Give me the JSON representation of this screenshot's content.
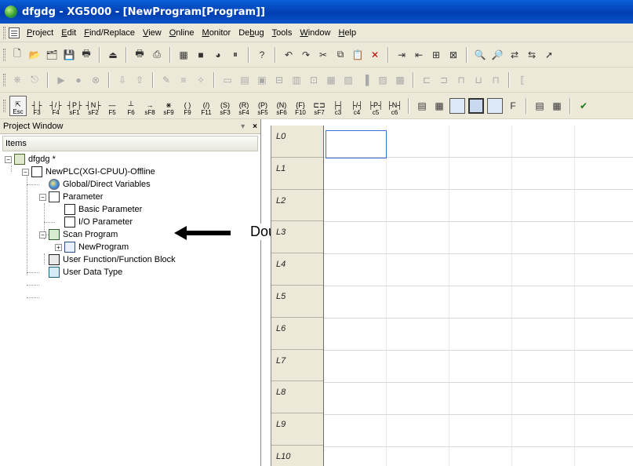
{
  "window": {
    "title": "dfgdg - XG5000 - [NewProgram[Program]]"
  },
  "menubar": {
    "items": [
      {
        "label": "Project",
        "accel": "P"
      },
      {
        "label": "Edit",
        "accel": "E"
      },
      {
        "label": "Find/Replace",
        "accel": "F"
      },
      {
        "label": "View",
        "accel": "V"
      },
      {
        "label": "Online",
        "accel": "O"
      },
      {
        "label": "Monitor",
        "accel": "M"
      },
      {
        "label": "Debug",
        "accel": "b"
      },
      {
        "label": "Tools",
        "accel": "T"
      },
      {
        "label": "Window",
        "accel": "W"
      },
      {
        "label": "Help",
        "accel": "H"
      }
    ]
  },
  "toolbar_keys": [
    {
      "sym": "",
      "lbl": "Esc"
    },
    {
      "sym": "┤├",
      "lbl": "F3"
    },
    {
      "sym": "┤/├",
      "lbl": "F4"
    },
    {
      "sym": "┤P├",
      "lbl": "sF1"
    },
    {
      "sym": "┤N├",
      "lbl": "sF2"
    },
    {
      "sym": "—",
      "lbl": "F5"
    },
    {
      "sym": "┴",
      "lbl": "F6"
    },
    {
      "sym": "→",
      "lbl": "sF8"
    },
    {
      "sym": "⋇",
      "lbl": "sF9"
    },
    {
      "sym": "( )",
      "lbl": "F9"
    },
    {
      "sym": "(/)",
      "lbl": "F11"
    },
    {
      "sym": "(S)",
      "lbl": "sF3"
    },
    {
      "sym": "(R)",
      "lbl": "sF4"
    },
    {
      "sym": "(P)",
      "lbl": "sF5"
    },
    {
      "sym": "(N)",
      "lbl": "sF6"
    },
    {
      "sym": "{F}",
      "lbl": "F10"
    },
    {
      "sym": "⊏⊐",
      "lbl": "sF7"
    },
    {
      "sym": "├┤",
      "lbl": "c3"
    },
    {
      "sym": "├/┤",
      "lbl": "c4"
    },
    {
      "sym": "├P┤",
      "lbl": "c5"
    },
    {
      "sym": "├N┤",
      "lbl": "c6"
    }
  ],
  "project_window": {
    "title": "Project Window",
    "pin_label": "▾",
    "close_label": "×",
    "column_header": "Items",
    "tree": {
      "project": "dfgdg *",
      "plc": "NewPLC(XGI-CPUU)-Offline",
      "global_vars": "Global/Direct Variables",
      "parameter": "Parameter",
      "basic_param": "Basic Parameter",
      "io_param": "I/O Parameter",
      "scan_program": "Scan Program",
      "new_program": "NewProgram",
      "user_fb": "User Function/Function Block",
      "user_dt": "User Data Type"
    }
  },
  "annotation": {
    "label": "Double-click"
  },
  "editor": {
    "rungs": [
      "L0",
      "L1",
      "L2",
      "L3",
      "L4",
      "L5",
      "L6",
      "L7",
      "L8",
      "L9",
      "L10"
    ]
  }
}
